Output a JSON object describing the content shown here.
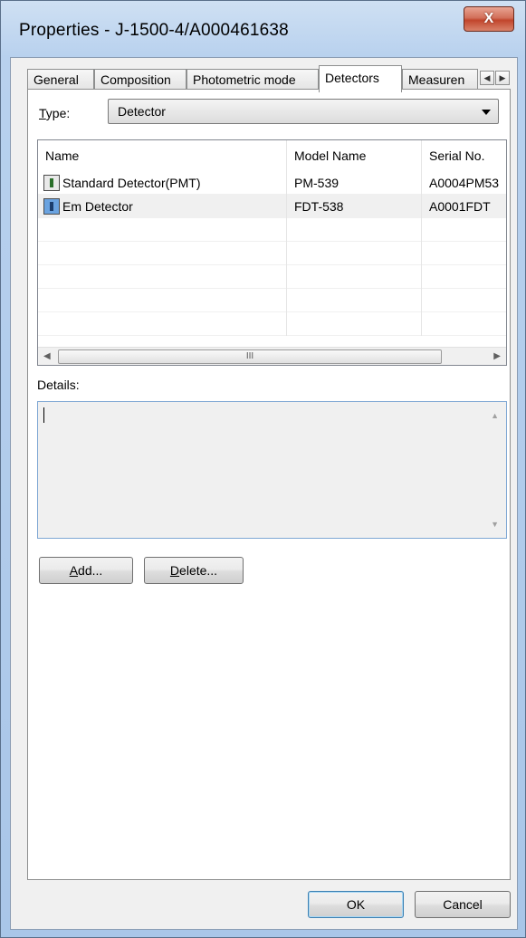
{
  "window": {
    "title": "Properties - J-1500-4/A000461638",
    "close_glyph": "X"
  },
  "tabs": [
    {
      "label": "General",
      "active": false
    },
    {
      "label": "Composition",
      "active": false
    },
    {
      "label": "Photometric mode",
      "active": false
    },
    {
      "label": "Detectors",
      "active": true
    },
    {
      "label": "Measuren",
      "active": false
    }
  ],
  "tab_scroll": {
    "left": "◀",
    "right": "▶"
  },
  "type": {
    "label_prefix": "T",
    "label_rest": "ype:",
    "selected": "Detector"
  },
  "detectors_list": {
    "columns": [
      "Name",
      "Model Name",
      "Serial No."
    ],
    "rows": [
      {
        "name": "Standard Detector(PMT)",
        "model": "PM-539",
        "serial": "A0004PM53",
        "icon": "pmt-detector-icon"
      },
      {
        "name": "Em Detector",
        "model": "FDT-538",
        "serial": "A0001FDT",
        "icon": "em-detector-icon"
      }
    ],
    "scroll_left": "◀",
    "scroll_right": "▶",
    "thumb_grip": "III"
  },
  "details": {
    "label": "Details:",
    "value": ""
  },
  "buttons": {
    "add": {
      "accel": "A",
      "rest": "dd..."
    },
    "delete": {
      "accel": "D",
      "rest": "elete..."
    },
    "ok": "OK",
    "cancel": "Cancel"
  }
}
